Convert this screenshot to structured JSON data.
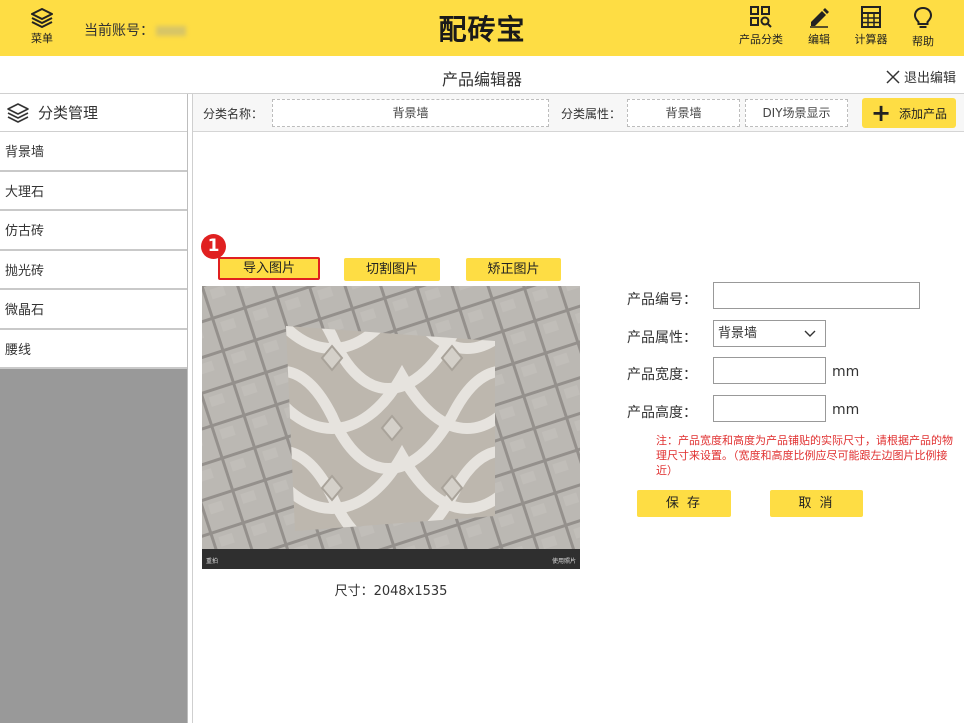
{
  "header": {
    "menu_label": "菜单",
    "account_label": "当前账号：",
    "brand": "配砖宝",
    "tools": [
      {
        "label": "产品分类",
        "icon": "grid-search-icon"
      },
      {
        "label": "编辑",
        "icon": "pencil-icon"
      },
      {
        "label": "计算器",
        "icon": "calculator-icon"
      },
      {
        "label": "帮助",
        "icon": "lightbulb-icon"
      }
    ],
    "accent_color": "#fedd44"
  },
  "subheader": {
    "title": "产品编辑器",
    "exit_label": "退出编辑"
  },
  "sidebar": {
    "title": "分类管理",
    "items": [
      "背景墙",
      "大理石",
      "仿古砖",
      "抛光砖",
      "微晶石",
      "腰线"
    ]
  },
  "filter": {
    "category_name_label": "分类名称：",
    "category_name_value": "背景墙",
    "category_attr_label": "分类属性：",
    "category_attr_value": "背景墙",
    "diy_label": "DIY场景显示",
    "add_label": "添加产品"
  },
  "image_tools": {
    "step_badge": "1",
    "import_label": "导入图片",
    "cut_label": "切割图片",
    "correct_label": "矫正图片",
    "photo_left_caption": "重拍",
    "photo_right_caption": "使用照片",
    "size_label": "尺寸：2048x1535"
  },
  "form": {
    "code_label": "产品编号：",
    "code_value": "",
    "attr_label": "产品属性：",
    "attr_value": "背景墙",
    "width_label": "产品宽度：",
    "width_value": "",
    "width_unit": "mm",
    "height_label": "产品高度：",
    "height_value": "",
    "height_unit": "mm",
    "note": "注：产品宽度和高度为产品铺贴的实际尺寸，请根据产品的物理尺寸来设置。（宽度和高度比例应尽可能跟左边图片比例接近）",
    "save_label": "保 存",
    "cancel_label": "取 消"
  }
}
